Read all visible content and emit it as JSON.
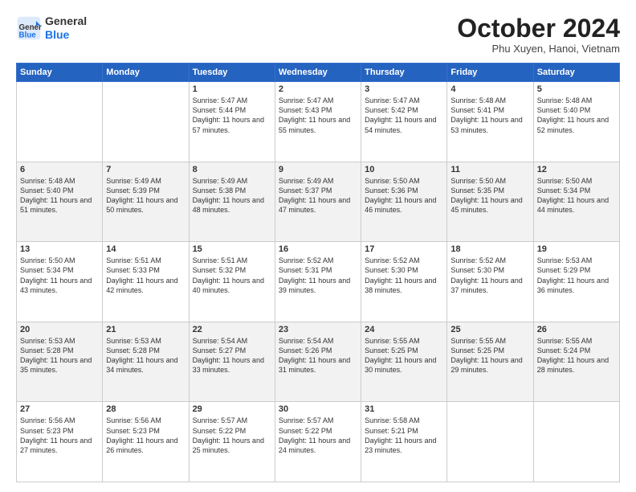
{
  "header": {
    "logo_general": "General",
    "logo_blue": "Blue",
    "month_title": "October 2024",
    "subtitle": "Phu Xuyen, Hanoi, Vietnam"
  },
  "weekdays": [
    "Sunday",
    "Monday",
    "Tuesday",
    "Wednesday",
    "Thursday",
    "Friday",
    "Saturday"
  ],
  "weeks": [
    [
      {
        "day": "",
        "info": ""
      },
      {
        "day": "",
        "info": ""
      },
      {
        "day": "1",
        "info": "Sunrise: 5:47 AM\nSunset: 5:44 PM\nDaylight: 11 hours and 57 minutes."
      },
      {
        "day": "2",
        "info": "Sunrise: 5:47 AM\nSunset: 5:43 PM\nDaylight: 11 hours and 55 minutes."
      },
      {
        "day": "3",
        "info": "Sunrise: 5:47 AM\nSunset: 5:42 PM\nDaylight: 11 hours and 54 minutes."
      },
      {
        "day": "4",
        "info": "Sunrise: 5:48 AM\nSunset: 5:41 PM\nDaylight: 11 hours and 53 minutes."
      },
      {
        "day": "5",
        "info": "Sunrise: 5:48 AM\nSunset: 5:40 PM\nDaylight: 11 hours and 52 minutes."
      }
    ],
    [
      {
        "day": "6",
        "info": "Sunrise: 5:48 AM\nSunset: 5:40 PM\nDaylight: 11 hours and 51 minutes."
      },
      {
        "day": "7",
        "info": "Sunrise: 5:49 AM\nSunset: 5:39 PM\nDaylight: 11 hours and 50 minutes."
      },
      {
        "day": "8",
        "info": "Sunrise: 5:49 AM\nSunset: 5:38 PM\nDaylight: 11 hours and 48 minutes."
      },
      {
        "day": "9",
        "info": "Sunrise: 5:49 AM\nSunset: 5:37 PM\nDaylight: 11 hours and 47 minutes."
      },
      {
        "day": "10",
        "info": "Sunrise: 5:50 AM\nSunset: 5:36 PM\nDaylight: 11 hours and 46 minutes."
      },
      {
        "day": "11",
        "info": "Sunrise: 5:50 AM\nSunset: 5:35 PM\nDaylight: 11 hours and 45 minutes."
      },
      {
        "day": "12",
        "info": "Sunrise: 5:50 AM\nSunset: 5:34 PM\nDaylight: 11 hours and 44 minutes."
      }
    ],
    [
      {
        "day": "13",
        "info": "Sunrise: 5:50 AM\nSunset: 5:34 PM\nDaylight: 11 hours and 43 minutes."
      },
      {
        "day": "14",
        "info": "Sunrise: 5:51 AM\nSunset: 5:33 PM\nDaylight: 11 hours and 42 minutes."
      },
      {
        "day": "15",
        "info": "Sunrise: 5:51 AM\nSunset: 5:32 PM\nDaylight: 11 hours and 40 minutes."
      },
      {
        "day": "16",
        "info": "Sunrise: 5:52 AM\nSunset: 5:31 PM\nDaylight: 11 hours and 39 minutes."
      },
      {
        "day": "17",
        "info": "Sunrise: 5:52 AM\nSunset: 5:30 PM\nDaylight: 11 hours and 38 minutes."
      },
      {
        "day": "18",
        "info": "Sunrise: 5:52 AM\nSunset: 5:30 PM\nDaylight: 11 hours and 37 minutes."
      },
      {
        "day": "19",
        "info": "Sunrise: 5:53 AM\nSunset: 5:29 PM\nDaylight: 11 hours and 36 minutes."
      }
    ],
    [
      {
        "day": "20",
        "info": "Sunrise: 5:53 AM\nSunset: 5:28 PM\nDaylight: 11 hours and 35 minutes."
      },
      {
        "day": "21",
        "info": "Sunrise: 5:53 AM\nSunset: 5:28 PM\nDaylight: 11 hours and 34 minutes."
      },
      {
        "day": "22",
        "info": "Sunrise: 5:54 AM\nSunset: 5:27 PM\nDaylight: 11 hours and 33 minutes."
      },
      {
        "day": "23",
        "info": "Sunrise: 5:54 AM\nSunset: 5:26 PM\nDaylight: 11 hours and 31 minutes."
      },
      {
        "day": "24",
        "info": "Sunrise: 5:55 AM\nSunset: 5:25 PM\nDaylight: 11 hours and 30 minutes."
      },
      {
        "day": "25",
        "info": "Sunrise: 5:55 AM\nSunset: 5:25 PM\nDaylight: 11 hours and 29 minutes."
      },
      {
        "day": "26",
        "info": "Sunrise: 5:55 AM\nSunset: 5:24 PM\nDaylight: 11 hours and 28 minutes."
      }
    ],
    [
      {
        "day": "27",
        "info": "Sunrise: 5:56 AM\nSunset: 5:23 PM\nDaylight: 11 hours and 27 minutes."
      },
      {
        "day": "28",
        "info": "Sunrise: 5:56 AM\nSunset: 5:23 PM\nDaylight: 11 hours and 26 minutes."
      },
      {
        "day": "29",
        "info": "Sunrise: 5:57 AM\nSunset: 5:22 PM\nDaylight: 11 hours and 25 minutes."
      },
      {
        "day": "30",
        "info": "Sunrise: 5:57 AM\nSunset: 5:22 PM\nDaylight: 11 hours and 24 minutes."
      },
      {
        "day": "31",
        "info": "Sunrise: 5:58 AM\nSunset: 5:21 PM\nDaylight: 11 hours and 23 minutes."
      },
      {
        "day": "",
        "info": ""
      },
      {
        "day": "",
        "info": ""
      }
    ]
  ]
}
